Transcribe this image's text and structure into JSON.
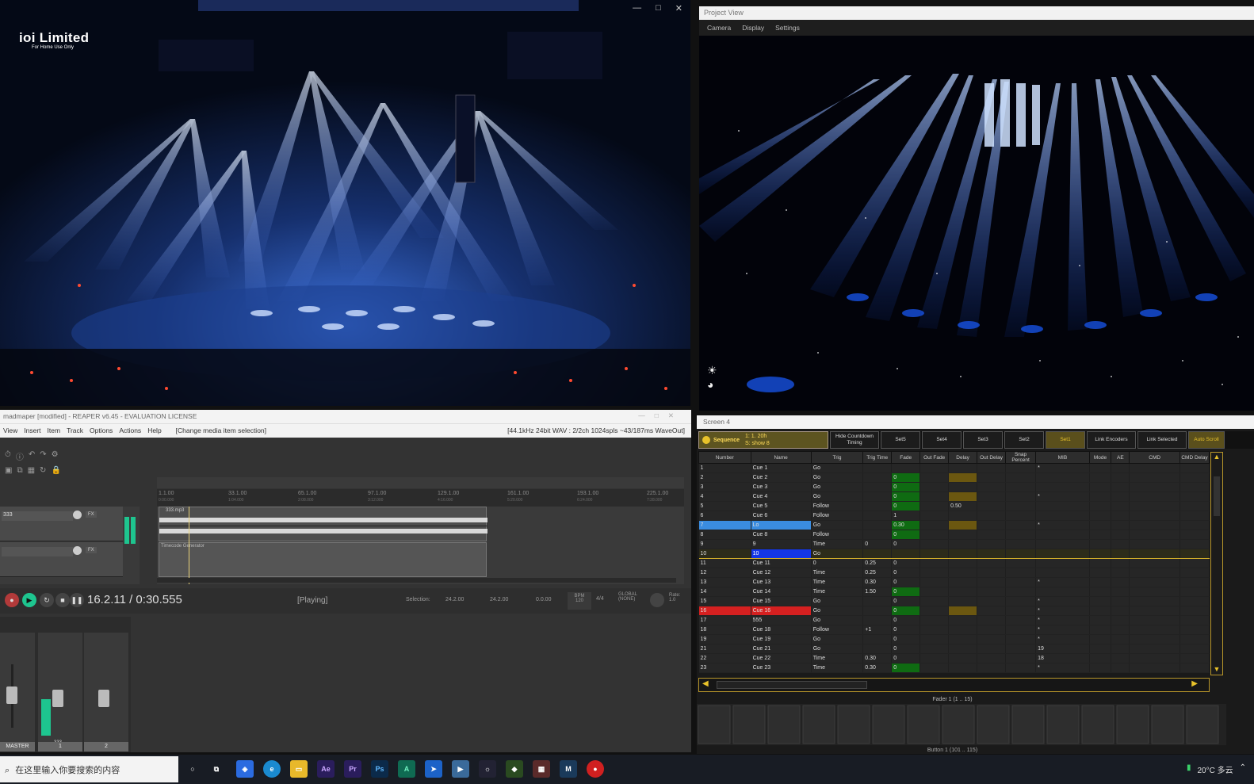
{
  "video_window": {
    "logo_title": "ioi Limited",
    "logo_subtitle": "For Home Use Only"
  },
  "project_view": {
    "title": "Project View",
    "menu": [
      "Camera",
      "Display",
      "Settings"
    ]
  },
  "reaper": {
    "title": "madmaper [modified] - REAPER v6.45 - EVALUATION LICENSE",
    "menu": [
      "View",
      "Insert",
      "Item",
      "Track",
      "Options",
      "Actions",
      "Help"
    ],
    "menu_status": "[Change media item selection]",
    "audio_format": "[44.1kHz 24bit WAV : 2/2ch 1024spls ~43/187ms WaveOut]",
    "ruler": [
      {
        "bar": "1.1.00",
        "time": "0:00.000"
      },
      {
        "bar": "33.1.00",
        "time": "1:04.000"
      },
      {
        "bar": "65.1.00",
        "time": "2:08.000"
      },
      {
        "bar": "97.1.00",
        "time": "3:12.000"
      },
      {
        "bar": "129.1.00",
        "time": "4:16.000"
      },
      {
        "bar": "161.1.00",
        "time": "5:20.000"
      },
      {
        "bar": "193.1.00",
        "time": "6:24.000"
      },
      {
        "bar": "225.1.00",
        "time": "7:28.000"
      }
    ],
    "tracks": [
      {
        "name": "333",
        "fx": "FX"
      },
      {
        "name": "",
        "fx": "FX"
      }
    ],
    "item_label": "333.mp3",
    "item_label2": "Timecode Generator",
    "time_display": "16.2.11 / 0:30.555",
    "play_state": "[Playing]",
    "selection_label": "Selection:",
    "sel_start": "24.2.00",
    "sel_end": "24.2.00",
    "sel_len": "0.0.00",
    "bpm_label": "BPM",
    "bpm": "120",
    "time_sig": "4/4",
    "global_label": "GLOBAL",
    "global_val": "(NONE)",
    "rate_label": "Rate:",
    "rate_val": "1.0",
    "mixer_labels": [
      "MASTER",
      "1",
      "2"
    ],
    "mixer_track_name": "333"
  },
  "screen4": {
    "title": "Screen 4",
    "sequence_label": "Sequence",
    "seq_line1": "1:  1. 20h",
    "seq_line2": "S: show 8",
    "buttons": [
      "Hide Countdown Timing",
      "Set5",
      "Set4",
      "Set3",
      "Set2",
      "Set1",
      "Link Encoders",
      "Link Selected",
      "Auto Scroll"
    ],
    "columns": [
      "Number",
      "Name",
      "Trig",
      "Trig Time",
      "Fade",
      "Out Fade",
      "Delay",
      "Out Delay",
      "Snap Percent",
      "MIB",
      "Mode",
      "AE",
      "CMD",
      "CMD Delay"
    ],
    "rows": [
      {
        "num": "1",
        "name": "Cue 1",
        "trig": "Go",
        "trig_time": "",
        "fade": "",
        "delay": "",
        "mib": "*"
      },
      {
        "num": "2",
        "name": "Cue 2",
        "trig": "Go",
        "trig_time": "",
        "fade": "0",
        "delay": "",
        "mib": ""
      },
      {
        "num": "3",
        "name": "Cue 3",
        "trig": "Go",
        "trig_time": "",
        "fade": "0",
        "delay": "",
        "mib": ""
      },
      {
        "num": "4",
        "name": "Cue 4",
        "trig": "Go",
        "trig_time": "",
        "fade": "0",
        "delay": "",
        "mib": "*"
      },
      {
        "num": "5",
        "name": "Cue 5",
        "trig": "Follow",
        "trig_time": "",
        "fade": "0",
        "delay": "0.50",
        "mib": ""
      },
      {
        "num": "6",
        "name": "Cue 6",
        "trig": "Follow",
        "trig_time": "",
        "fade": "1",
        "delay": "",
        "mib": ""
      },
      {
        "num": "7",
        "name": "Lo",
        "trig": "Go",
        "trig_time": "",
        "fade": "0.30",
        "delay": "",
        "mib": "*"
      },
      {
        "num": "8",
        "name": "Cue 8",
        "trig": "Follow",
        "trig_time": "",
        "fade": "0",
        "delay": "",
        "mib": ""
      },
      {
        "num": "9",
        "name": "9",
        "trig": "Time",
        "trig_time": "0",
        "fade": "0",
        "delay": "",
        "mib": ""
      },
      {
        "num": "10",
        "name": "10",
        "trig": "Go",
        "trig_time": "",
        "fade": "",
        "delay": "",
        "mib": ""
      },
      {
        "num": "11",
        "name": "Cue 11",
        "trig": "0",
        "trig_time": "0.25",
        "fade": "0",
        "delay": "",
        "mib": ""
      },
      {
        "num": "12",
        "name": "Cue 12",
        "trig": "Time",
        "trig_time": "0.25",
        "fade": "0",
        "delay": "",
        "mib": ""
      },
      {
        "num": "13",
        "name": "Cue 13",
        "trig": "Time",
        "trig_time": "0.30",
        "fade": "0",
        "delay": "",
        "mib": "*"
      },
      {
        "num": "14",
        "name": "Cue 14",
        "trig": "Time",
        "trig_time": "1.50",
        "fade": "0",
        "delay": "",
        "mib": ""
      },
      {
        "num": "15",
        "name": "Cue 15",
        "trig": "Go",
        "trig_time": "",
        "fade": "0",
        "delay": "",
        "mib": "*"
      },
      {
        "num": "16",
        "name": "Cue 16",
        "trig": "Go",
        "trig_time": "",
        "fade": "0",
        "delay": "",
        "mib": "*"
      },
      {
        "num": "17",
        "name": "555",
        "trig": "Go",
        "trig_time": "",
        "fade": "0",
        "delay": "",
        "mib": "*"
      },
      {
        "num": "18",
        "name": "Cue 18",
        "trig": "Follow",
        "trig_time": "+1",
        "fade": "0",
        "delay": "",
        "mib": "*"
      },
      {
        "num": "19",
        "name": "Cue 19",
        "trig": "Go",
        "trig_time": "",
        "fade": "0",
        "delay": "",
        "mib": "*"
      },
      {
        "num": "21",
        "name": "Cue 21",
        "trig": "Go",
        "trig_time": "",
        "fade": "0",
        "delay": "",
        "mib": "19"
      },
      {
        "num": "22",
        "name": "Cue 22",
        "trig": "Time",
        "trig_time": "0.30",
        "fade": "0",
        "delay": "",
        "mib": "18"
      },
      {
        "num": "23",
        "name": "Cue 23",
        "trig": "Time",
        "trig_time": "0.30",
        "fade": "0",
        "delay": "",
        "mib": "*"
      }
    ],
    "fader_label": "Fader  1 (1 .. 15)",
    "button_label": "Button  1 (101 .. 115)"
  },
  "taskbar": {
    "search_placeholder": "在这里输入你要搜索的内容",
    "weather": "20°C 多云",
    "apps": [
      "Ae",
      "Pr",
      "Ps",
      "A"
    ]
  }
}
